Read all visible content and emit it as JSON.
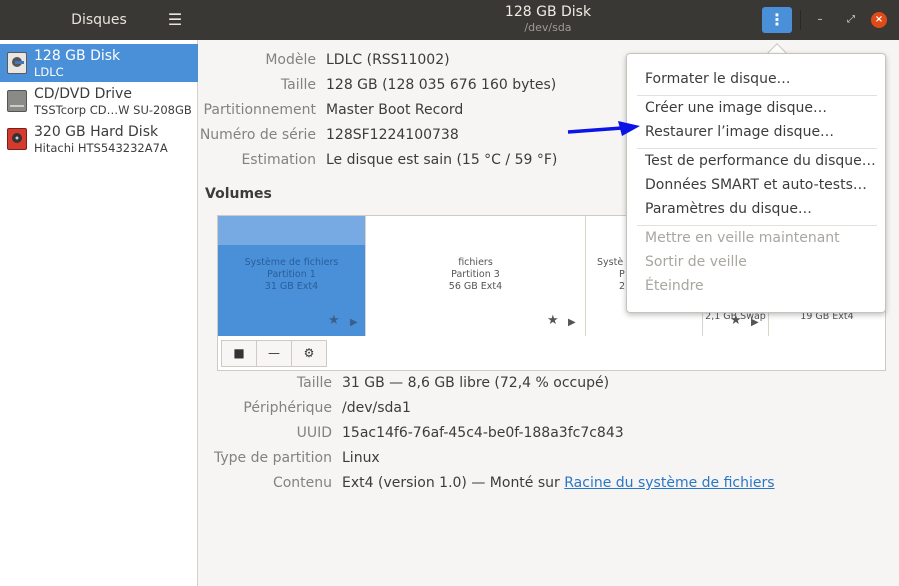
{
  "header": {
    "sidebar_title": "Disques",
    "title": "128 GB Disk",
    "subtitle": "/dev/sda",
    "hamburger_icon": "hamburger-menu-icon",
    "menu_icon": "kebab-menu-icon",
    "accent": "#4a90d9"
  },
  "sidebar": {
    "disks": [
      {
        "name": "128 GB Disk",
        "model": "LDLC",
        "icon": "ssd-icon",
        "selected": true
      },
      {
        "name": "CD/DVD Drive",
        "model": "TSSTcorp CD…W SU-208GB",
        "icon": "optical-drive-icon",
        "selected": false
      },
      {
        "name": "320 GB Hard Disk",
        "model": "Hitachi HTS543232A7A",
        "icon": "hard-disk-icon",
        "selected": false
      }
    ]
  },
  "disk_props": {
    "model_label": "Modèle",
    "model_value": "LDLC (RSS11002)",
    "size_label": "Taille",
    "size_value": "128 GB (128 035 676 160 bytes)",
    "part_label": "Partitionnement",
    "part_value": "Master Boot Record",
    "serial_label": "Numéro de série",
    "serial_value": "128SF1224100738",
    "health_label": "Estimation",
    "health_value": "Le disque est sain (15 °C / 59 °F)"
  },
  "volumes": {
    "title": "Volumes",
    "items": [
      {
        "line1": "Système de fichiers",
        "line2": "Partition 1",
        "line3": "31 GB Ext4"
      },
      {
        "line1": "fichiers",
        "line2": "Partition 3",
        "line3": "56 GB Ext4"
      },
      {
        "line1": "Systè",
        "line2": "P",
        "line3": "2"
      },
      {
        "line1": "2,1 GB Swap"
      },
      {
        "line1": "19 GB Ext4"
      }
    ],
    "toolbar": [
      "stop-icon",
      "minus-icon",
      "gears-icon"
    ]
  },
  "volume_props": {
    "size_label": "Taille",
    "size_value": "31 GB — 8,6 GB libre (72,4 % occupé)",
    "device_label": "Périphérique",
    "device_value": "/dev/sda1",
    "uuid_label": "UUID",
    "uuid_value": "15ac14f6-76af-45c4-be0f-188a3fc7c843",
    "ptype_label": "Type de partition",
    "ptype_value": "Linux",
    "content_label": "Contenu",
    "content_value": "Ext4 (version 1.0) — Monté sur",
    "content_link": "Racine du système de fichiers"
  },
  "menu": {
    "items": [
      {
        "label": "Formater le disque…",
        "enabled": true
      },
      {
        "label": "Créer une image disque…",
        "enabled": true
      },
      {
        "label": "Restaurer l’image disque…",
        "enabled": true
      },
      {
        "label": "Test de performance du disque…",
        "enabled": true
      },
      {
        "label": "Données SMART et auto-tests…",
        "enabled": true
      },
      {
        "label": "Paramètres du disque…",
        "enabled": true
      },
      {
        "label": "Mettre en veille maintenant",
        "enabled": false
      },
      {
        "label": "Sortir de veille",
        "enabled": false
      },
      {
        "label": "Éteindre",
        "enabled": false
      }
    ]
  },
  "annotation": {
    "arrow_color": "#0a14e6"
  }
}
